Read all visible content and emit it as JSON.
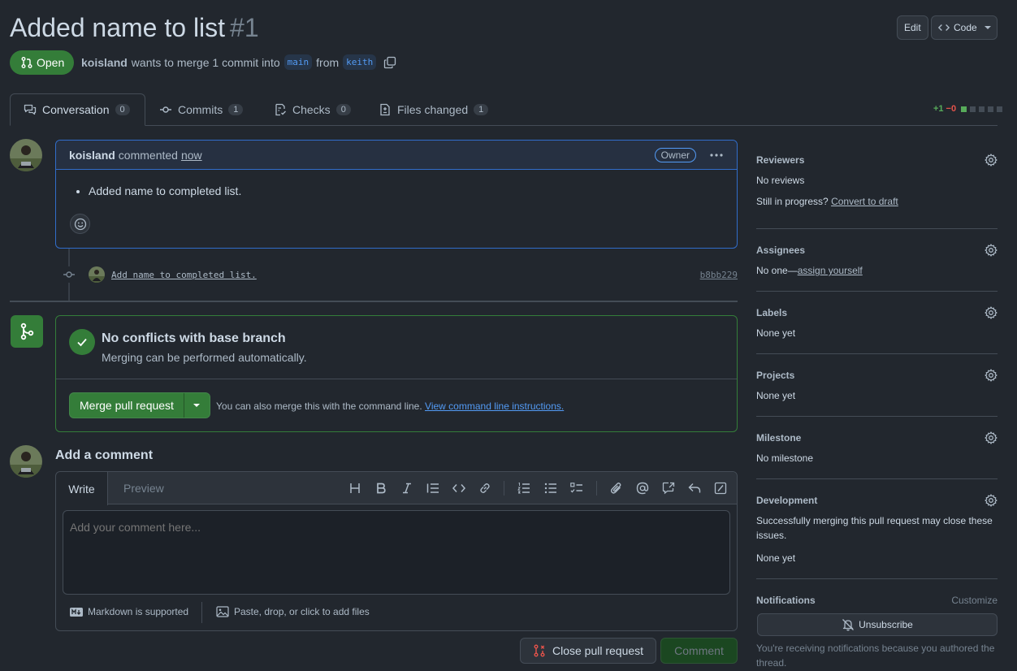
{
  "pr": {
    "title": "Added name to list",
    "number": "#1",
    "state": "Open",
    "author": "koisland",
    "merge_text": "wants to merge 1 commit into",
    "base_branch": "main",
    "from_text": "from",
    "head_branch": "keith"
  },
  "header": {
    "edit_label": "Edit",
    "code_label": "Code"
  },
  "tabs": [
    {
      "label": "Conversation",
      "count": "0"
    },
    {
      "label": "Commits",
      "count": "1"
    },
    {
      "label": "Checks",
      "count": "0"
    },
    {
      "label": "Files changed",
      "count": "1"
    }
  ],
  "diffstat": {
    "additions": "+1",
    "deletions": "−0"
  },
  "comment": {
    "author": "koisland",
    "action": "commented",
    "time": "now",
    "role": "Owner",
    "body_items": [
      "Added name to completed list."
    ]
  },
  "commit": {
    "message": "Add name to completed list.",
    "sha": "b8bb229"
  },
  "merge": {
    "title": "No conflicts with base branch",
    "subtitle": "Merging can be performed automatically.",
    "button_label": "Merge pull request",
    "hint": "You can also merge this with the command line.",
    "hint_link": "View command line instructions."
  },
  "add_comment": {
    "title": "Add a comment",
    "tab_write": "Write",
    "tab_preview": "Preview",
    "placeholder": "Add your comment here...",
    "markdown_note": "Markdown is supported",
    "attach_note": "Paste, drop, or click to add files",
    "close_button": "Close pull request",
    "comment_button": "Comment"
  },
  "sidebar": {
    "reviewers": {
      "heading": "Reviewers",
      "value": "No reviews",
      "progress_prefix": "Still in progress?",
      "progress_link": "Convert to draft"
    },
    "assignees": {
      "heading": "Assignees",
      "value_prefix": "No one—",
      "value_link": "assign yourself"
    },
    "labels": {
      "heading": "Labels",
      "value": "None yet"
    },
    "projects": {
      "heading": "Projects",
      "value": "None yet"
    },
    "milestone": {
      "heading": "Milestone",
      "value": "No milestone"
    },
    "development": {
      "heading": "Development",
      "description": "Successfully merging this pull request may close these issues.",
      "value": "None yet"
    },
    "notifications": {
      "heading": "Notifications",
      "customize": "Customize",
      "button": "Unsubscribe",
      "note": "You're receiving notifications because you authored the thread."
    }
  },
  "colors": {
    "background": "#22272e",
    "accent_green": "#347d39",
    "accent_blue": "#316dca",
    "danger": "#e5534b"
  }
}
